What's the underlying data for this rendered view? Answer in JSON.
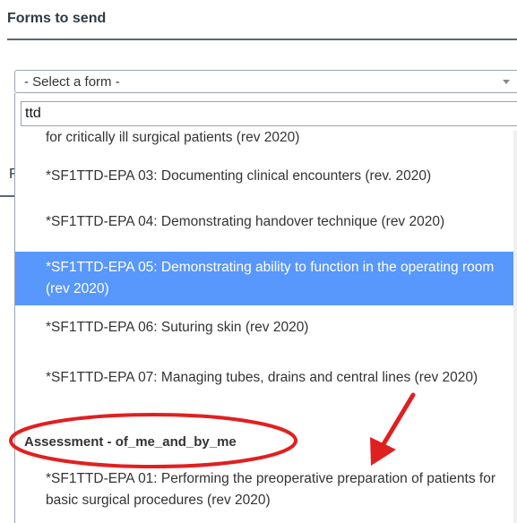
{
  "page": {
    "title": "Forms to send"
  },
  "background": {
    "partial_letter": "F"
  },
  "select": {
    "selected_label": "- Select a form -"
  },
  "search": {
    "value": "ttd"
  },
  "options": [
    {
      "label": "for critically ill surgical patients (rev 2020)"
    },
    {
      "label": "*SF1TTD-EPA 03: Documenting clinical encounters (rev. 2020)"
    },
    {
      "label": "*SF1TTD-EPA 04: Demonstrating handover technique (rev 2020)"
    },
    {
      "label": "*SF1TTD-EPA 05: Demonstrating ability to function in the operating room (rev 2020)",
      "selected": true
    },
    {
      "label": "*SF1TTD-EPA 06: Suturing skin (rev 2020)"
    },
    {
      "label": "*SF1TTD-EPA 07: Managing tubes, drains and central lines (rev 2020)"
    }
  ],
  "group": {
    "label": "Assessment - of_me_and_by_me",
    "options": [
      {
        "label": "*SF1TTD-EPA 01: Performing the preoperative preparation of patients for basic surgical procedures (rev 2020)"
      }
    ]
  },
  "colors": {
    "selected_background": "#5897fb",
    "annotation": "#e02020"
  }
}
